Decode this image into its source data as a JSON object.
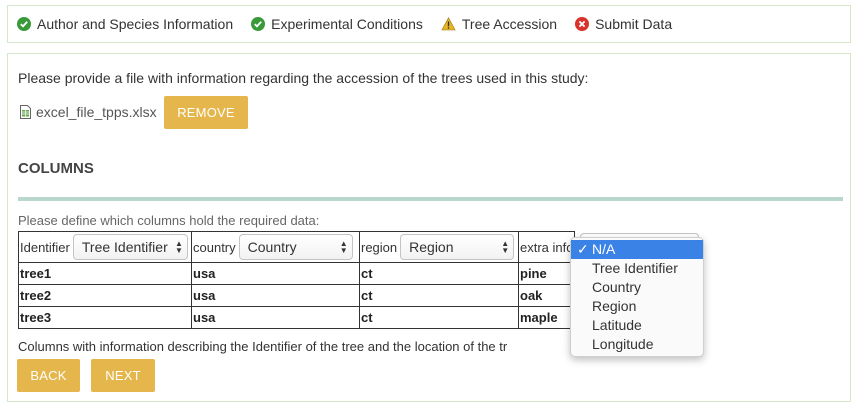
{
  "steps": [
    {
      "label": "Author and Species Information",
      "status": "complete",
      "icon": "check-circle-icon",
      "color": "#3a9a3a"
    },
    {
      "label": "Experimental Conditions",
      "status": "complete",
      "icon": "check-circle-icon",
      "color": "#3a9a3a"
    },
    {
      "label": "Tree Accession",
      "status": "warning",
      "icon": "warning-triangle-icon",
      "color": "#e9b528"
    },
    {
      "label": "Submit Data",
      "status": "error",
      "icon": "x-circle-icon",
      "color": "#d9312b"
    }
  ],
  "panel": {
    "prompt": "Please provide a file with information regarding the accession of the trees used in this study:",
    "file_name": "excel_file_tpps.xlsx",
    "remove_label": "REMOVE",
    "columns_title": "COLUMNS",
    "define_text": "Please define which columns hold the required data:",
    "table": {
      "headers": [
        {
          "label": "Identifier",
          "selected": "Tree Identifier"
        },
        {
          "label": "country",
          "selected": "Country"
        },
        {
          "label": "region",
          "selected": "Region"
        },
        {
          "label": "extra info",
          "selected": "N/A"
        }
      ],
      "rows": [
        [
          "tree1",
          "usa",
          "ct",
          "pine"
        ],
        [
          "tree2",
          "usa",
          "ct",
          "oak"
        ],
        [
          "tree3",
          "usa",
          "ct",
          "maple"
        ]
      ]
    },
    "footnote": "Columns with information describing the Identifier of the tree and the location of the tr",
    "back_label": "BACK",
    "next_label": "NEXT"
  },
  "dropdown": {
    "options": [
      "N/A",
      "Tree Identifier",
      "Country",
      "Region",
      "Latitude",
      "Longitude"
    ],
    "selected_index": 0,
    "check": "✓"
  },
  "colors": {
    "accent": "#e5b64c",
    "rule": "#b9d7cb",
    "selection": "#3b82e6"
  }
}
